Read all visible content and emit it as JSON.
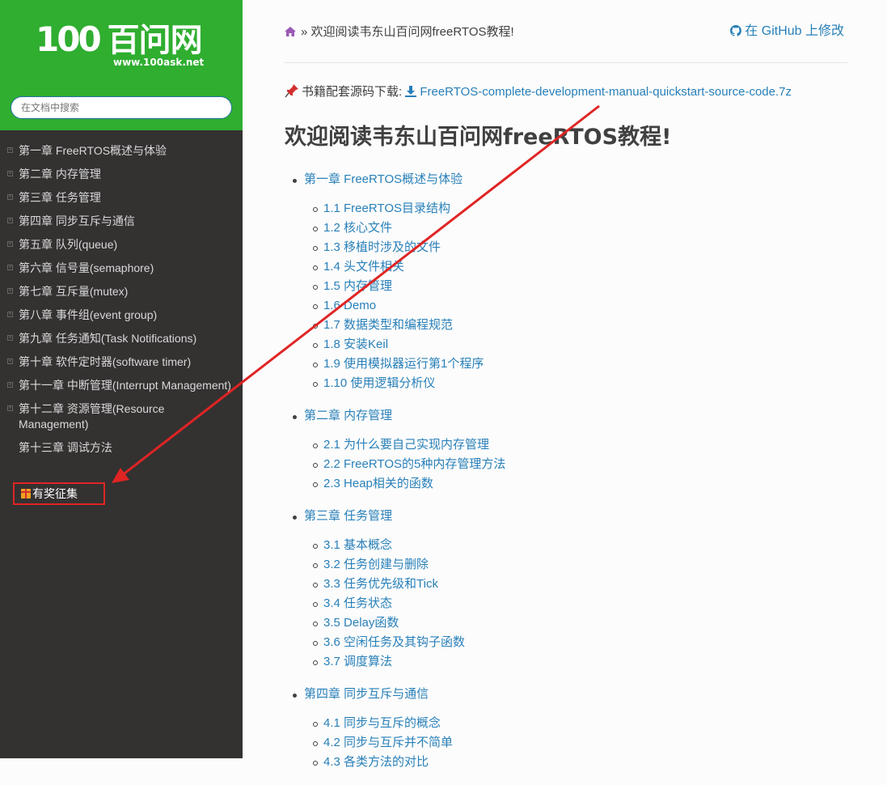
{
  "sidebar": {
    "logo_text_num": "100",
    "logo_text_cn": "百问网",
    "logo_url": "www.100ask.net",
    "search_placeholder": "在文档中搜索",
    "items": [
      {
        "label": "第一章 FreeRTOS概述与体验",
        "expandable": true
      },
      {
        "label": "第二章 内存管理",
        "expandable": true
      },
      {
        "label": "第三章 任务管理",
        "expandable": true
      },
      {
        "label": "第四章 同步互斥与通信",
        "expandable": true
      },
      {
        "label": "第五章 队列(queue)",
        "expandable": true
      },
      {
        "label": "第六章 信号量(semaphore)",
        "expandable": true
      },
      {
        "label": "第七章 互斥量(mutex)",
        "expandable": true
      },
      {
        "label": "第八章 事件组(event group)",
        "expandable": true
      },
      {
        "label": "第九章 任务通知(Task Notifications)",
        "expandable": true
      },
      {
        "label": "第十章 软件定时器(software timer)",
        "expandable": true
      },
      {
        "label": "第十一章 中断管理(Interrupt Management)",
        "expandable": true
      },
      {
        "label": "第十二章 资源管理(Resource Management)",
        "expandable": true
      },
      {
        "label": "第十三章 调试方法",
        "expandable": false
      }
    ],
    "special_item": "有奖征集"
  },
  "header": {
    "breadcrumb_sep": "»",
    "breadcrumb_current": "欢迎阅读韦东山百问网freeRTOS教程!",
    "github_link": "在 GitHub 上修改"
  },
  "download": {
    "label": "书籍配套源码下载:",
    "file": "FreeRTOS-complete-development-manual-quickstart-source-code.7z"
  },
  "title": "欢迎阅读韦东山百问网freeRTOS教程!",
  "toc": [
    {
      "title": "第一章 FreeRTOS概述与体验",
      "sections": [
        "1.1 FreeRTOS目录结构",
        "1.2 核心文件",
        "1.3 移植时涉及的文件",
        "1.4 头文件相关",
        "1.5 内存管理",
        "1.6 Demo",
        "1.7 数据类型和编程规范",
        "1.8 安装Keil",
        "1.9 使用模拟器运行第1个程序",
        "1.10 使用逻辑分析仪"
      ]
    },
    {
      "title": "第二章 内存管理",
      "sections": [
        "2.1 为什么要自己实现内存管理",
        "2.2 FreeRTOS的5种内存管理方法",
        "2.3 Heap相关的函数"
      ]
    },
    {
      "title": "第三章 任务管理",
      "sections": [
        "3.1 基本概念",
        "3.2 任务创建与删除",
        "3.3 任务优先级和Tick",
        "3.4 任务状态",
        "3.5 Delay函数",
        "3.6 空闲任务及其钩子函数",
        "3.7 调度算法"
      ]
    },
    {
      "title": "第四章 同步互斥与通信",
      "sections": [
        "4.1 同步与互斥的概念",
        "4.2 同步与互斥并不简单",
        "4.3 各类方法的对比"
      ]
    }
  ],
  "colors": {
    "brand_green": "#2fae30",
    "sidebar_bg": "#343131",
    "link": "#2980b9",
    "annotation_red": "#e02424"
  }
}
